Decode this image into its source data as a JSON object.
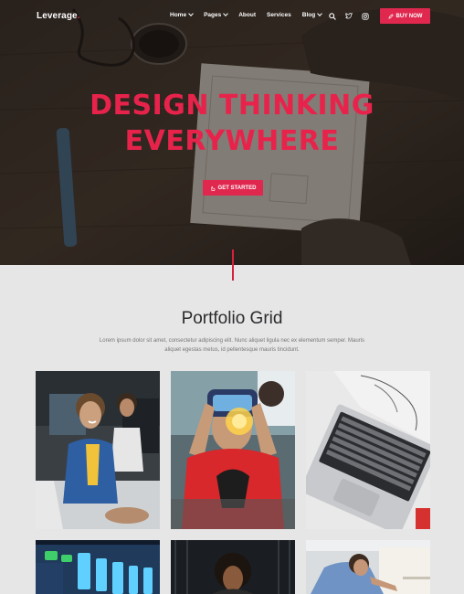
{
  "nav": {
    "logo": "Leverage",
    "logo_dot": ".",
    "links": [
      {
        "label": "Home",
        "has_dropdown": true
      },
      {
        "label": "Pages",
        "has_dropdown": true
      },
      {
        "label": "About",
        "has_dropdown": false
      },
      {
        "label": "Services",
        "has_dropdown": false
      },
      {
        "label": "Blog",
        "has_dropdown": true
      }
    ],
    "icons": [
      "search-icon",
      "twitter-icon",
      "instagram-icon"
    ],
    "buy_label": "BUY NOW"
  },
  "hero": {
    "title_line1": "DESIGN THINKING",
    "title_line2": "EVERYWHERE",
    "cta_label": "GET STARTED"
  },
  "portfolio": {
    "title": "Portfolio Grid",
    "description": "Lorem ipsum dolor sit amet, consectetur adipiscing elit. Nunc aliquet ligula nec ex elementum semper. Mauris aliquet egestas metus, id pellentesque mauris tincidunt.",
    "items": [
      {
        "image": "office-team-photo"
      },
      {
        "image": "vr-headset-photo"
      },
      {
        "image": "laptop-sketch-photo"
      },
      {
        "image": "server-lights-photo"
      },
      {
        "image": "woman-portrait-photo"
      },
      {
        "image": "man-at-desk-photo"
      }
    ]
  },
  "colors": {
    "accent": "#e0284f",
    "hero_title": "#e8234b",
    "section_bg": "#e6e6e6",
    "heading": "#2b2b2f"
  }
}
